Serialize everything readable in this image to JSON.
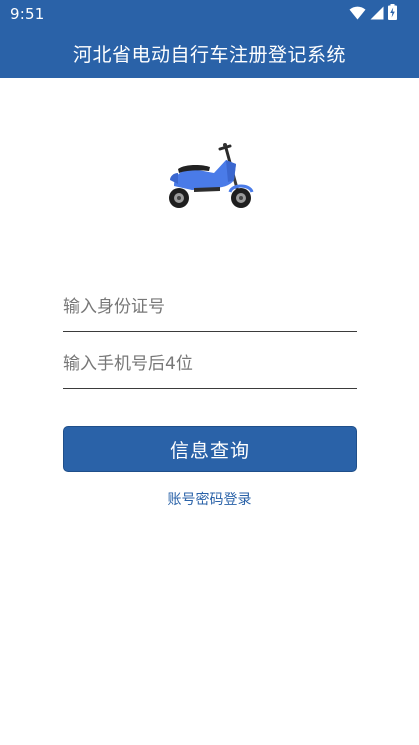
{
  "status_bar": {
    "time": "9:51",
    "icons": [
      "wifi-icon",
      "signal-icon",
      "battery-charging-icon"
    ]
  },
  "app_bar": {
    "title": "河北省电动自行车注册登记系统"
  },
  "form": {
    "id_number": {
      "placeholder": "输入身份证号",
      "value": ""
    },
    "phone_last4": {
      "placeholder": "输入手机号后4位",
      "value": ""
    },
    "submit_label": "信息查询",
    "alt_login_label": "账号密码登录"
  },
  "colors": {
    "primary": "#2a62a8",
    "scooter_body": "#4a7be8"
  }
}
